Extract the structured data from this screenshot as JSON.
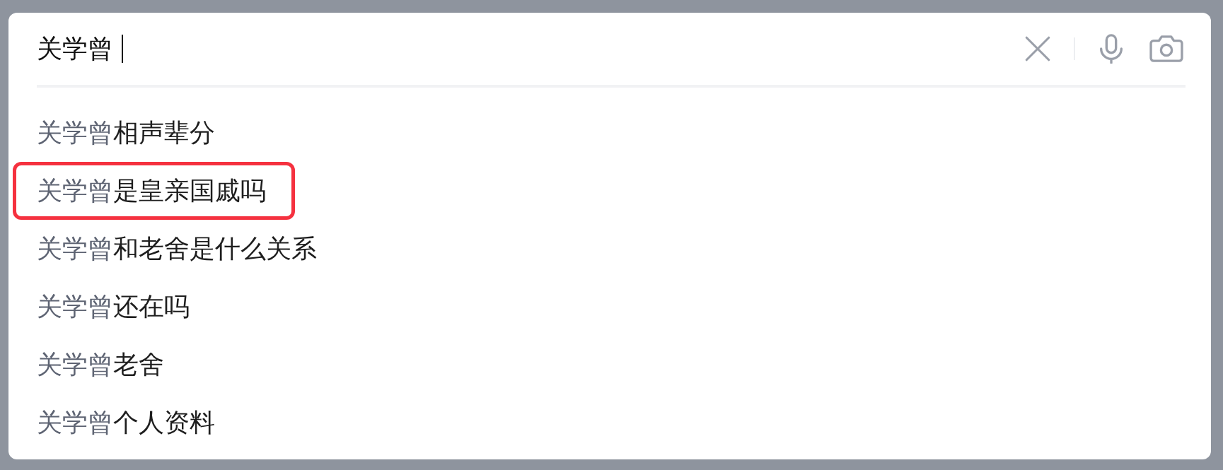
{
  "search": {
    "value": "关学曾"
  },
  "suggestions": [
    {
      "prefix": "关学曾",
      "rest": "相声辈分",
      "highlighted": false
    },
    {
      "prefix": "关学曾",
      "rest": "是皇亲国戚吗",
      "highlighted": true
    },
    {
      "prefix": "关学曾",
      "rest": "和老舍是什么关系",
      "highlighted": false
    },
    {
      "prefix": "关学曾",
      "rest": "还在吗",
      "highlighted": false
    },
    {
      "prefix": "关学曾",
      "rest": "老舍",
      "highlighted": false
    },
    {
      "prefix": "关学曾",
      "rest": "个人资料",
      "highlighted": false
    }
  ]
}
